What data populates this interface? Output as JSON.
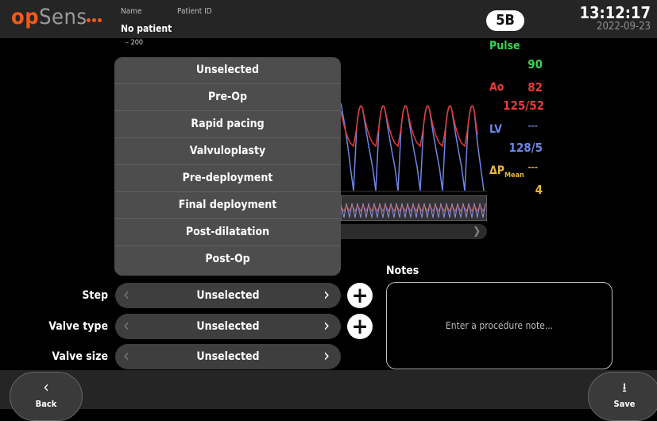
{
  "header": {
    "logo_op": "op",
    "logo_sens": "Sens",
    "name_label": "Name",
    "patient_id_label": "Patient ID",
    "name_value": "No patient",
    "room": "5B",
    "time": "13:12:17",
    "date": "2022-09-23"
  },
  "waveform": {
    "scale_label": "– 200"
  },
  "dropdown": {
    "options": [
      "Unselected",
      "Pre-Op",
      "Rapid pacing",
      "Valvuloplasty",
      "Pre-deployment",
      "Final deployment",
      "Post-dilatation",
      "Post-Op"
    ]
  },
  "vitals": {
    "pulse": {
      "label": "Pulse",
      "value": "90",
      "color": "#39d353"
    },
    "ao": {
      "label": "Ao",
      "mean": "82",
      "sys_dia": "125/52",
      "color": "#e63b3b"
    },
    "lv": {
      "label": "LV",
      "mean": "---",
      "sys_dia": "128/5",
      "color": "#6f86e6"
    },
    "dp": {
      "label": "ΔP",
      "sub": "Mean",
      "mean": "---",
      "value": "4",
      "color": "#e8b93a"
    }
  },
  "form": {
    "step": {
      "label": "Step",
      "value": "Unselected"
    },
    "valve_type": {
      "label": "Valve type",
      "value": "Unselected"
    },
    "valve_size": {
      "label": "Valve size",
      "value": "Unselected"
    }
  },
  "notes": {
    "title": "Notes",
    "placeholder": "Enter a procedure note..."
  },
  "footer": {
    "back_label": "Back",
    "save_label": "Save"
  }
}
